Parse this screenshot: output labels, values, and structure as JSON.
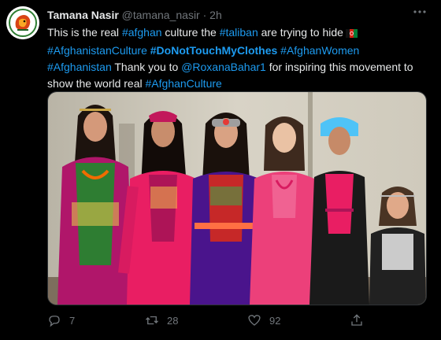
{
  "tweet": {
    "author_name": "Tamana Nasir",
    "handle": "@tamana_nasir",
    "separator": "·",
    "time": "2h",
    "text_parts": [
      {
        "text": "This is the real ",
        "style": "plain"
      },
      {
        "text": "#afghan",
        "style": "link"
      },
      {
        "text": " culture the ",
        "style": "plain"
      },
      {
        "text": "#taliban",
        "style": "link"
      },
      {
        "text": " are trying to hide",
        "style": "plain"
      }
    ],
    "line2_parts": [
      {
        "text": "#AfghanistanCulture",
        "style": "link"
      },
      {
        "text": " ",
        "style": "plain"
      },
      {
        "text": "#DoNotTouchMyClothes",
        "style": "link-bold"
      },
      {
        "text": " ",
        "style": "plain"
      },
      {
        "text": "#AfghanWomen",
        "style": "link"
      }
    ],
    "line3_parts": [
      {
        "text": "#Afghanistan",
        "style": "link"
      },
      {
        "text": " Thank you to ",
        "style": "plain"
      },
      {
        "text": "@RoxanaBahar1",
        "style": "link"
      },
      {
        "text": " for inspiring this movement to",
        "style": "plain"
      }
    ],
    "line4_parts": [
      {
        "text": "show the world real ",
        "style": "plain"
      },
      {
        "text": "#AfghanCulture",
        "style": "link"
      }
    ],
    "flag_emoji": "flag-afghanistan",
    "actions": {
      "reply_count": "7",
      "retweet_count": "28",
      "like_count": "92"
    },
    "colors": {
      "background": "#000000",
      "text": "#e7e9ea",
      "secondary": "#71767b",
      "link": "#1d9bf0"
    }
  }
}
